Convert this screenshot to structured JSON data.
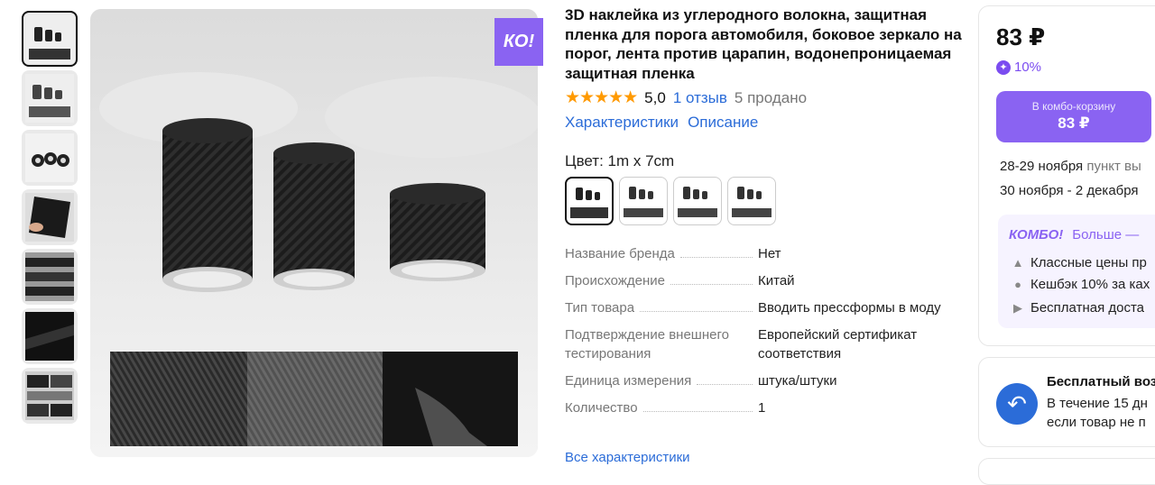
{
  "product": {
    "badge": "КО!",
    "title": "3D наклейка из углеродного волокна, защитная пленка для порога автомобиля, боковое зеркало на порог, лента против царапин, водонепроницаемая защитная пленка",
    "rating": "5,0",
    "reviews": "1 отзыв",
    "sold": "5 продано",
    "tab_characteristics": "Характеристики",
    "tab_description": "Описание",
    "color_label": "Цвет: 1m x 7cm",
    "variant_count": 4,
    "thumbnail_count": 7
  },
  "specs": [
    {
      "key": "Название бренда",
      "value": "Нет"
    },
    {
      "key": "Происхождение",
      "value": "Китай"
    },
    {
      "key": "Тип товара",
      "value": "Вводить прессформы в моду"
    },
    {
      "key": "Подтверждение внешнего тестирования",
      "value": "Европейский сертификат соответствия"
    },
    {
      "key": "Единица измерения",
      "value": "штука/штуки"
    },
    {
      "key": "Количество",
      "value": "1"
    }
  ],
  "all_specs_link": "Все характеристики",
  "buy": {
    "price": "83 ₽",
    "cashback": "10%",
    "combo_button_top": "В комбо-корзину",
    "combo_button_price": "83 ₽",
    "delivery1_date": "28-29 ноября",
    "delivery1_place": "пункт вы",
    "delivery2": "30 ноября - 2 декабря",
    "combo_logo": "КОМБО!",
    "combo_more": "Больше —",
    "combo_line1": "Классные цены пр",
    "combo_line2": "Кешбэк 10% за ках",
    "combo_line3": "Бесплатная доста"
  },
  "returns": {
    "title": "Бесплатный воз",
    "line1": "В течение 15 дн",
    "line2": "если товар не п"
  },
  "colors": {
    "accent": "#8a63f2",
    "link": "#2b6cd8",
    "star": "#ff9a00"
  }
}
